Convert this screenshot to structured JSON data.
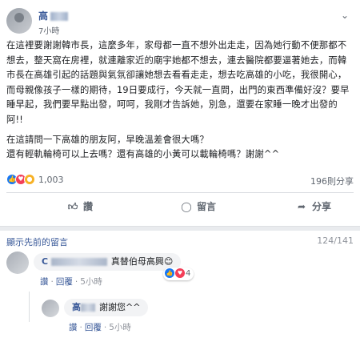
{
  "post": {
    "author_visible": "高",
    "time": "7小時",
    "menu_icon": "chevron-down-icon",
    "paragraphs": [
      "在這裡要謝謝韓市長，這麼多年，家母都一直不想外出走走，因為她行動不便那都不想去，整天窩在房裡，就連離家近的廟宇她都不想去，連去醫院都要逼著她去，而韓市長在高雄引起的話題與氣氛卻讓她想去看看走走，想去吃高雄的小吃，我很開心，而母親像孩子一樣的期待，19日要成行，今天就一直問，出門的東西準備好沒？要早睡早起，我們要早點出發，呵呵，我剛才告訴她，別急，還要在家睡一晚才出發的阿!!",
      "在這請問一下高雄的朋友阿，早晚溫差會很大嗎？\n還有輕軌輪椅可以上去嗎？還有高雄的小黃可以載輪椅嗎？謝謝^^"
    ],
    "reaction_count": "1,003",
    "share_count": "196則分享",
    "reaction_icons": [
      "like-icon",
      "love-icon",
      "wow-icon"
    ],
    "actions": {
      "like": "讚",
      "comment": "留言",
      "share": "分享"
    }
  },
  "comments": {
    "previous_label": "顯示先前的留言",
    "count": "124/141",
    "items": [
      {
        "name_visible": "C",
        "text": "真替伯母高興😊",
        "like_label": "讚",
        "reply_label": "回覆",
        "ago": "5小時",
        "reactions_count": "4"
      },
      {
        "name_visible": "高",
        "text": "謝謝您^^",
        "like_label": "讚",
        "reply_label": "回覆",
        "ago": "5小時"
      }
    ]
  },
  "colors": {
    "link": "#385898",
    "like_blue": "#1877f2",
    "love_red": "#f33e58",
    "wow_yellow": "#f7b125"
  }
}
